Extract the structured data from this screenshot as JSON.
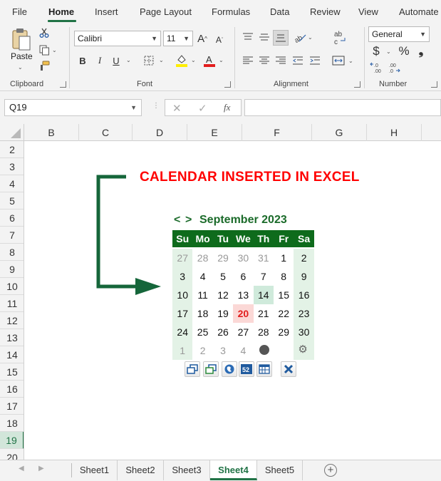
{
  "ribbon_tabs": [
    {
      "label": "File"
    },
    {
      "label": "Home",
      "active": true
    },
    {
      "label": "Insert"
    },
    {
      "label": "Page Layout"
    },
    {
      "label": "Formulas"
    },
    {
      "label": "Data"
    },
    {
      "label": "Review"
    },
    {
      "label": "View"
    },
    {
      "label": "Automate"
    }
  ],
  "clipboard": {
    "paste_label": "Paste",
    "group_label": "Clipboard"
  },
  "font": {
    "name": "Calibri",
    "size": "11",
    "group_label": "Font",
    "bold": "B",
    "italic": "I",
    "underline": "U",
    "highlight_color": "#ffee00",
    "font_color": "#e21d1d"
  },
  "alignment": {
    "group_label": "Alignment"
  },
  "number": {
    "format": "General",
    "group_label": "Number",
    "currency": "$",
    "percent": "%",
    "comma": "❟"
  },
  "formula_bar": {
    "name_box": "Q19",
    "cancel": "✕",
    "enter": "✓",
    "fx": "fx",
    "value": ""
  },
  "columns": [
    "B",
    "C",
    "D",
    "E",
    "F",
    "G",
    "H"
  ],
  "rows": [
    "2",
    "3",
    "4",
    "5",
    "6",
    "7",
    "8",
    "9",
    "10",
    "11",
    "12",
    "13",
    "14",
    "15",
    "16",
    "17",
    "18",
    "19",
    "20"
  ],
  "selected_row": "19",
  "title": "CALENDAR INSERTED IN EXCEL",
  "accent_color": "#217346",
  "calendar": {
    "prev": "<",
    "next": ">",
    "month_label": "September 2023",
    "weekdays": [
      "Su",
      "Mo",
      "Tu",
      "We",
      "Th",
      "Fr",
      "Sa"
    ],
    "weeks": [
      [
        "27",
        "28",
        "29",
        "30",
        "31",
        "1",
        "2"
      ],
      [
        "3",
        "4",
        "5",
        "6",
        "7",
        "8",
        "9"
      ],
      [
        "10",
        "11",
        "12",
        "13",
        "14",
        "15",
        "16"
      ],
      [
        "17",
        "18",
        "19",
        "20",
        "21",
        "22",
        "23"
      ],
      [
        "24",
        "25",
        "26",
        "27",
        "28",
        "29",
        "30"
      ],
      [
        "1",
        "2",
        "3",
        "4",
        "",
        "",
        ""
      ]
    ],
    "today": "20",
    "highlighted": "14",
    "header_color": "#0e6b1c",
    "today_color": "#e21d1d",
    "tools": [
      "restore-icon",
      "minimize-icon",
      "globe-icon",
      "week-number-icon",
      "calendar-icon",
      "close-icon"
    ],
    "week_number_label": "52"
  },
  "sheets": [
    {
      "name": "Sheet1"
    },
    {
      "name": "Sheet2"
    },
    {
      "name": "Sheet3"
    },
    {
      "name": "Sheet4",
      "active": true
    },
    {
      "name": "Sheet5"
    }
  ],
  "add_sheet": "+"
}
